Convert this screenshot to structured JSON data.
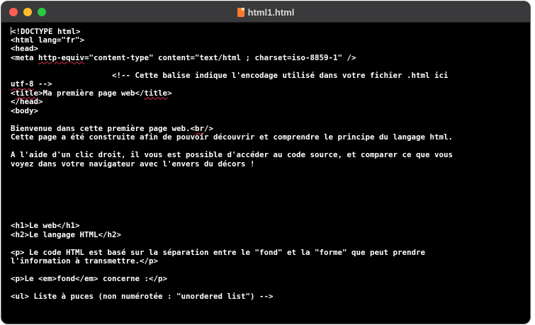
{
  "window": {
    "title": "html1.html",
    "icon": "html-file-icon"
  },
  "editor": {
    "lines": [
      [
        "",
        "!DOCTYPE html>"
      ],
      [
        "",
        "<html lang=\"fr\">"
      ],
      [
        "",
        "<head>"
      ],
      [
        "<meta ",
        "http-equiv",
        "=\"content-type\" content=\"text/html ; charset=iso-8859-1\" />"
      ],
      [
        "",
        ""
      ],
      [
        "",
        "                      <!-- Cette balise indique l'encodage utilisé dans votre fichier .html ici"
      ],
      [
        "",
        "utf-8",
        " -->"
      ],
      [
        "<",
        "title",
        ">Ma première page web</",
        "title",
        ">"
      ],
      [
        "",
        "</head>"
      ],
      [
        "",
        "<body>"
      ],
      [
        "",
        ""
      ],
      [
        "",
        "Bienvenue dans cette première page web.<",
        "br",
        "/>"
      ],
      [
        "",
        "Cette page a été construite afin de pouvoir découvrir et comprendre le principe du langage html."
      ],
      [
        "",
        ""
      ],
      [
        "",
        "A l'aide d'un clic droit, il vous est possible d'accéder au code source, et comparer ce que vous"
      ],
      [
        "",
        "voyez dans votre navigateur avec l'envers du décors !"
      ],
      [
        "",
        ""
      ],
      [
        "",
        ""
      ],
      [
        "",
        ""
      ],
      [
        "",
        ""
      ],
      [
        "",
        ""
      ],
      [
        "",
        ""
      ],
      [
        "",
        "<h1>Le web</h1>"
      ],
      [
        "",
        "<h2>Le langage HTML</h2>"
      ],
      [
        "",
        ""
      ],
      [
        "",
        "<p> Le code HTML est basé sur la séparation entre le \"fond\" et la \"forme\" que peut prendre"
      ],
      [
        "",
        "l'information à transmettre.</p>"
      ],
      [
        "",
        ""
      ],
      [
        "",
        "<p>Le <em>fond</em> concerne :</p>"
      ],
      [
        "",
        ""
      ],
      [
        "",
        "<ul> Liste à puces (non numérotée : \"unordered list\") -->"
      ]
    ]
  }
}
